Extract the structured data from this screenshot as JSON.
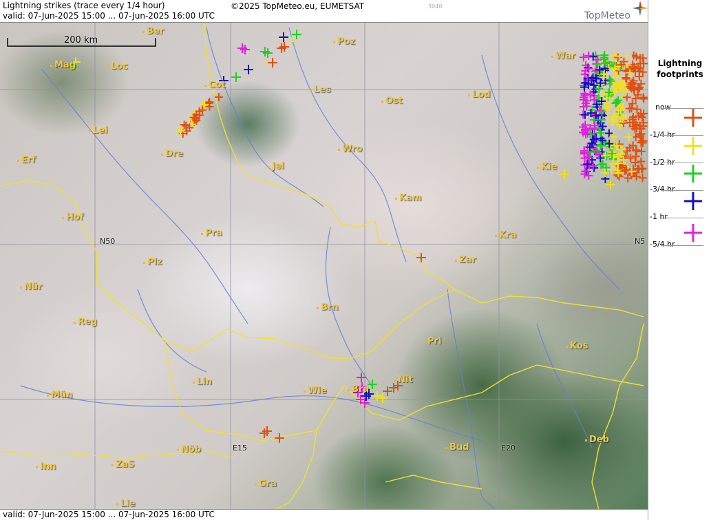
{
  "header": {
    "title": "Lightning strikes (trace every 1/4 hour)",
    "valid": "valid:  07-Jun-2025 15:00 ... 07-Jun-2025 16:00 UTC",
    "copyright": "©2025 TopMeteo.eu, EUMETSAT",
    "code": "3040",
    "logo": "TopMeteo"
  },
  "footer": {
    "valid": "valid:  07-Jun-2025 15:00 ... 07-Jun-2025 16:00 UTC"
  },
  "scale_label": "200 km",
  "grid_labels": {
    "n50": "N50",
    "n50_right": "N5",
    "e15": "E15",
    "e20": "E20"
  },
  "cities": {
    "ber": "Ber",
    "poz": "Poz",
    "war": "War",
    "mag": "Mag",
    "loc": "Loc",
    "cot": "Cot",
    "les": "Les",
    "lod": "Lod",
    "ost": "Ost",
    "lei": "Lei",
    "dre": "Dre",
    "wro": "Wro",
    "erf": "Erf",
    "jel": "Jel",
    "kie": "Kie",
    "kam": "Kam",
    "hof": "Hof",
    "pra": "Pra",
    "kra": "Kra",
    "plz": "Plz",
    "zar": "Zar",
    "nur": "Nür",
    "brn": "Brn",
    "reg": "Reg",
    "pri": "Pri",
    "kos": "Kos",
    "lin": "Lin",
    "nit": "Nit",
    "bra": "Bra",
    "mun": "Mün",
    "wie": "Wie",
    "deb": "Deb",
    "bud": "Bud",
    "nob": "Nöb",
    "inn": "Inn",
    "zas": "ZaS",
    "gra": "Gra",
    "lie": "Lie"
  },
  "legend": {
    "title_line1": "Lightning",
    "title_line2": "footprints",
    "entries": [
      {
        "label": "now",
        "color": "#e05010"
      },
      {
        "label": "-1/4 hr",
        "color": "#f0e020"
      },
      {
        "label": "-1/2 hr",
        "color": "#20d020"
      },
      {
        "label": "-3/4 hr",
        "color": "#1010c0"
      },
      {
        "label": "-1 hr",
        "color": "#e020e0"
      },
      {
        "label": "-5/4 hr",
        "color": ""
      }
    ]
  },
  "colors": {
    "borders": "#f0e030",
    "rivers": "#6080d8",
    "grid": "#9090a0",
    "city_label": "#f0c848"
  }
}
